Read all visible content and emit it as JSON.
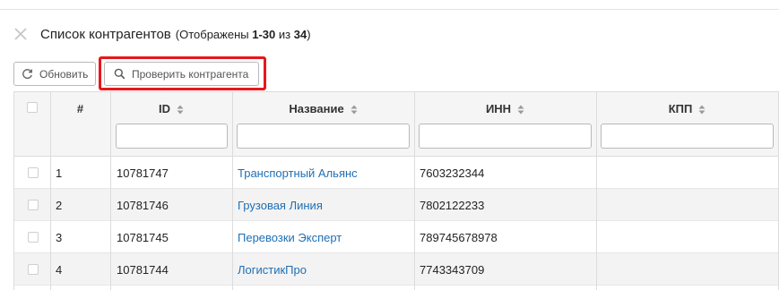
{
  "header": {
    "title": "Список контрагентов",
    "shown_prefix": "(Отображены ",
    "shown_range": "1-30",
    "shown_mid": " из ",
    "shown_total": "34",
    "shown_suffix": ")"
  },
  "toolbar": {
    "refresh_label": "Обновить",
    "check_label": "Проверить контрагента"
  },
  "table": {
    "columns": {
      "num": "#",
      "id": "ID",
      "name": "Название",
      "inn": "ИНН",
      "kpp": "КПП"
    },
    "rows": [
      {
        "num": "1",
        "id": "10781747",
        "name": "Транспортный Альянс",
        "inn": "7603232344",
        "kpp": ""
      },
      {
        "num": "2",
        "id": "10781746",
        "name": "Грузовая Линия",
        "inn": "7802122233",
        "kpp": ""
      },
      {
        "num": "3",
        "id": "10781745",
        "name": "Перевозки Эксперт",
        "inn": "789745678978",
        "kpp": ""
      },
      {
        "num": "4",
        "id": "10781744",
        "name": "ЛогистикПро",
        "inn": "7743343709",
        "kpp": ""
      }
    ]
  },
  "colors": {
    "accent_link": "#1f6fb5",
    "highlight": "#e8161b"
  },
  "icons": [
    "close-icon",
    "refresh-icon",
    "search-icon",
    "sort-icon"
  ]
}
